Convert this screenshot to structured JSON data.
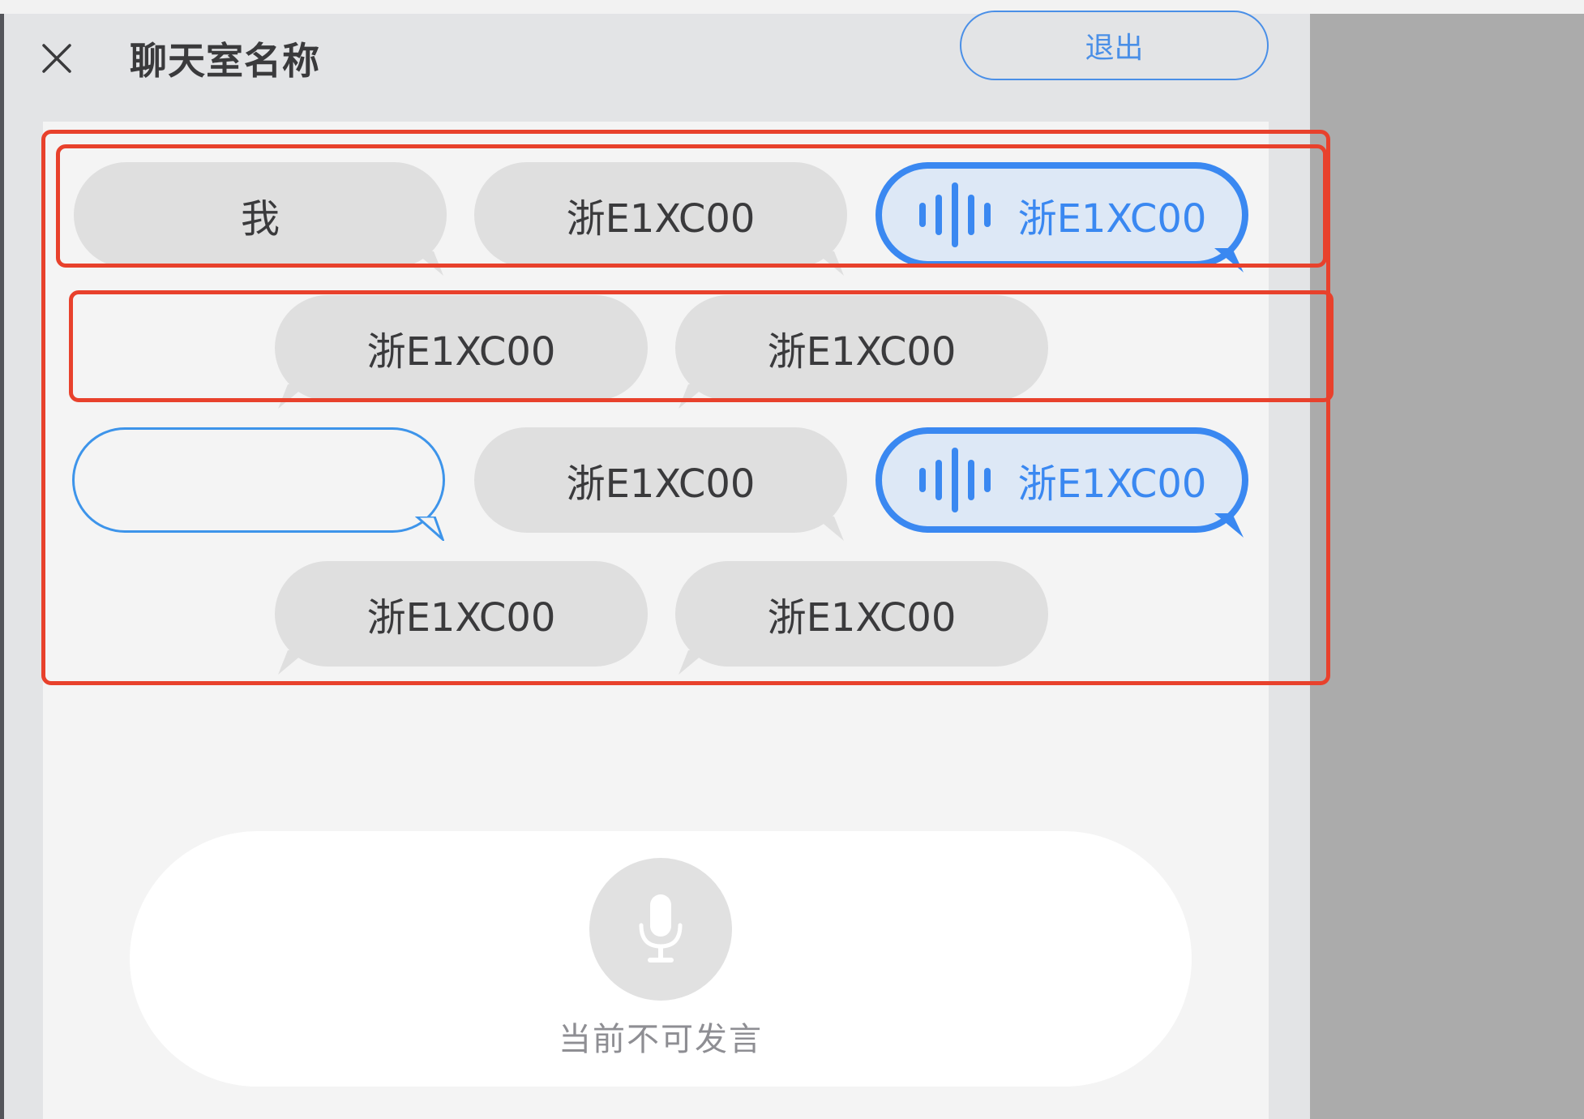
{
  "header": {
    "title": "聊天室名称",
    "exit_label": "退出"
  },
  "members": [
    {
      "name": "我",
      "state": "default"
    },
    {
      "name": "浙E1XC00",
      "state": "default"
    },
    {
      "name": "浙E1XC00",
      "state": "speaking"
    },
    {
      "name": "浙E1XC00",
      "state": "default"
    },
    {
      "name": "浙E1XC00",
      "state": "default"
    },
    {
      "name": "",
      "state": "empty"
    },
    {
      "name": "浙E1XC00",
      "state": "default"
    },
    {
      "name": "浙E1XC00",
      "state": "speaking"
    },
    {
      "name": "浙E1XC00",
      "state": "default"
    },
    {
      "name": "浙E1XC00",
      "state": "default"
    }
  ],
  "footer": {
    "status_text": "当前不可发言"
  },
  "icons": {
    "close": "close-icon",
    "voice": "voice-wave-icon",
    "mic": "microphone-icon"
  },
  "colors": {
    "accent": "#3a88f1",
    "highlight": "#e8412c",
    "bubble_default": "#dfdfdf",
    "bubble_speaking": "#dde8f6"
  }
}
